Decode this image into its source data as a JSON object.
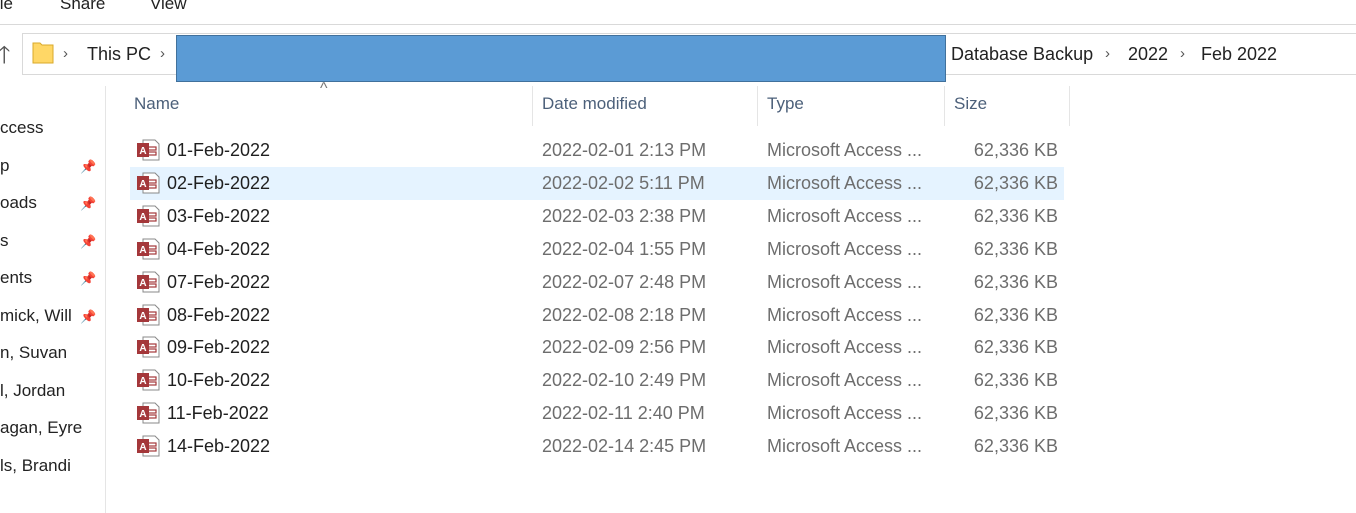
{
  "menu": {
    "items": [
      "ile",
      "Share",
      "View"
    ]
  },
  "address": {
    "crumbs": [
      "This PC",
      "Database Backup",
      "2022",
      "Feb 2022"
    ]
  },
  "sidebar": {
    "items": [
      {
        "label": "ccess",
        "pinned": false
      },
      {
        "label": "p",
        "pinned": true
      },
      {
        "label": "oads",
        "pinned": true
      },
      {
        "label": "s",
        "pinned": true
      },
      {
        "label": "ents",
        "pinned": true
      },
      {
        "label": "mick, Will",
        "pinned": true
      },
      {
        "label": "n, Suvan",
        "pinned": false
      },
      {
        "label": "l, Jordan",
        "pinned": false
      },
      {
        "label": "agan, Eyre",
        "pinned": false
      },
      {
        "label": "ls, Brandi",
        "pinned": false
      }
    ]
  },
  "columns": {
    "name": "Name",
    "date": "Date modified",
    "type": "Type",
    "size": "Size"
  },
  "files": [
    {
      "name": "01-Feb-2022",
      "date": "2022-02-01 2:13 PM",
      "type": "Microsoft Access ...",
      "size": "62,336 KB"
    },
    {
      "name": "02-Feb-2022",
      "date": "2022-02-02 5:11 PM",
      "type": "Microsoft Access ...",
      "size": "62,336 KB"
    },
    {
      "name": "03-Feb-2022",
      "date": "2022-02-03 2:38 PM",
      "type": "Microsoft Access ...",
      "size": "62,336 KB"
    },
    {
      "name": "04-Feb-2022",
      "date": "2022-02-04 1:55 PM",
      "type": "Microsoft Access ...",
      "size": "62,336 KB"
    },
    {
      "name": "07-Feb-2022",
      "date": "2022-02-07 2:48 PM",
      "type": "Microsoft Access ...",
      "size": "62,336 KB"
    },
    {
      "name": "08-Feb-2022",
      "date": "2022-02-08 2:18 PM",
      "type": "Microsoft Access ...",
      "size": "62,336 KB"
    },
    {
      "name": "09-Feb-2022",
      "date": "2022-02-09 2:56 PM",
      "type": "Microsoft Access ...",
      "size": "62,336 KB"
    },
    {
      "name": "10-Feb-2022",
      "date": "2022-02-10 2:49 PM",
      "type": "Microsoft Access ...",
      "size": "62,336 KB"
    },
    {
      "name": "11-Feb-2022",
      "date": "2022-02-11 2:40 PM",
      "type": "Microsoft Access ...",
      "size": "62,336 KB"
    },
    {
      "name": "14-Feb-2022",
      "date": "2022-02-14 2:45 PM",
      "type": "Microsoft Access ...",
      "size": "62,336 KB"
    }
  ],
  "selected_file": "02-Feb-2022",
  "colors": {
    "selection": "#e5f3ff",
    "redaction": "#5b9bd5",
    "access_icon": "#a4373a"
  }
}
